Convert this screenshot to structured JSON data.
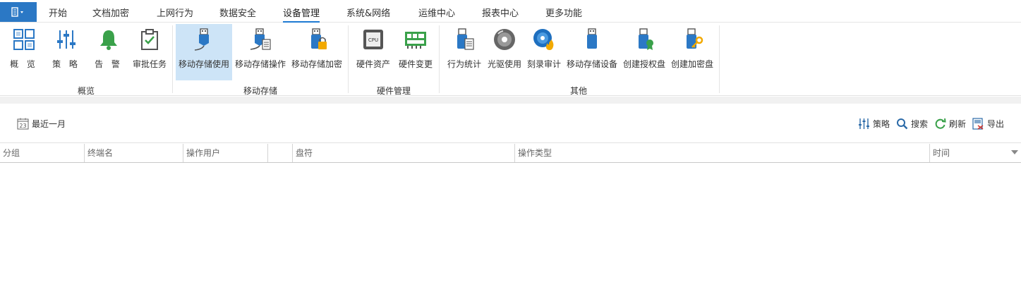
{
  "menu": {
    "items": [
      "开始",
      "文档加密",
      "上网行为",
      "数据安全",
      "设备管理",
      "系统&网络",
      "运维中心",
      "报表中心",
      "更多功能"
    ],
    "active": "设备管理"
  },
  "ribbon": {
    "buttons": {
      "overview": "概 览",
      "policy": "策 略",
      "alarm": "告 警",
      "approval": "审批任务",
      "usb_use": "移动存储使用",
      "usb_op": "移动存储操作",
      "usb_encrypt": "移动存储加密",
      "hw_assets": "硬件资产",
      "hw_change": "硬件变更",
      "behavior_stats": "行为统计",
      "optical_use": "光驱使用",
      "burn_audit": "刻录审计",
      "usb_device": "移动存储设备",
      "create_auth_disk": "创建授权盘",
      "create_enc_disk": "创建加密盘"
    },
    "groups": {
      "overview": "概览",
      "usb": "移动存储",
      "hardware": "硬件管理",
      "other": "其他"
    }
  },
  "toolbar": {
    "date_range": "最近一月",
    "date_icon_day": "23",
    "policy": "策略",
    "search": "搜索",
    "refresh": "刷新",
    "export": "导出"
  },
  "table": {
    "columns": [
      "分组",
      "终端名",
      "操作用户",
      "",
      "盘符",
      "操作类型",
      "时间"
    ]
  },
  "colors": {
    "accent": "#2b78c5",
    "selected_bg": "#cde4f7",
    "green": "#3aa14a"
  }
}
